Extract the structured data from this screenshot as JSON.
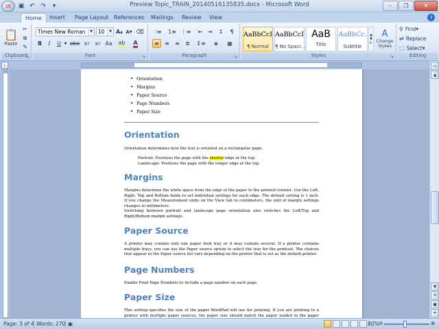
{
  "window": {
    "title": "Preview Topic_TRAIN_20140516135835.docx - Microsoft Word"
  },
  "tabs": [
    {
      "label": "Home",
      "active": true
    },
    {
      "label": "Insert"
    },
    {
      "label": "Page Layout"
    },
    {
      "label": "References"
    },
    {
      "label": "Mailings"
    },
    {
      "label": "Review"
    },
    {
      "label": "View"
    }
  ],
  "ribbon": {
    "clipboard": {
      "label": "Clipboard",
      "paste": "Paste"
    },
    "font": {
      "label": "Font",
      "font_name": "Times New Roman",
      "font_size": "10"
    },
    "paragraph": {
      "label": "Paragraph"
    },
    "styles": {
      "label": "Styles",
      "tiles": [
        {
          "preview": "AaBbCcI",
          "name": "¶ Normal"
        },
        {
          "preview": "AaBbCcI",
          "name": "¶ No Spaci..."
        },
        {
          "preview": "AaB",
          "name": "Title"
        },
        {
          "preview": "AaBbCc.",
          "name": "Subtitle"
        }
      ],
      "change_styles": "Change Styles"
    },
    "editing": {
      "label": "Editing",
      "find": "Find",
      "replace": "Replace",
      "select": "Select"
    }
  },
  "document": {
    "bullets": [
      "Orientation",
      "Margins",
      "Paper Source",
      "Page Numbers",
      "Paper Size"
    ],
    "orientation": {
      "heading": "Orientation",
      "intro": "Orientation determines how the text is oriented on a rectangular page.",
      "portrait_pre": "Portrait: Positions the page with the ",
      "portrait_hl": "shorter",
      "portrait_post": " edge at the top.",
      "landscape": "Landscape: Positions the page with the longer edge at the top."
    },
    "margins": {
      "heading": "Margins",
      "p1": "Margins determine the white space from the edge of the paper to the printed content. Use the Left, Right, Top and Bottom fields to set individual settings for each edge. The default setting is 1 inch. If you change the Measurement units on the View tab to centimeters, the unit of margin settings changes to millimeters.",
      "p2": "Switching between portrait and landscape page orientation also switches the Left/Top and Right/Bottom margin settings."
    },
    "paper_source": {
      "heading": "Paper Source",
      "p1": "A printer may contain only one paper feed tray or it may contain several. If a printer contains multiple trays, you can use the Paper source option to select the tray for the printout. The choices that appear in the Paper source list vary depending on the printer that is set as the default printer."
    },
    "page_numbers": {
      "heading": "Page Numbers",
      "p1": "Enable Print Page Numbers to include a page number on each page."
    },
    "paper_size": {
      "heading": "Paper Size",
      "p1": "This setting specifies the size of the paper WordPad will use for printing. If you are printing to a printer with multiple paper sources, the paper size should match the paper loaded in the paper source tray."
    }
  },
  "status": {
    "page": "Page: 3 of 4",
    "words": "Words: 270",
    "zoom": "80%"
  },
  "colors": {
    "heading": "#4f81bd",
    "highlight": "#ffff00"
  }
}
